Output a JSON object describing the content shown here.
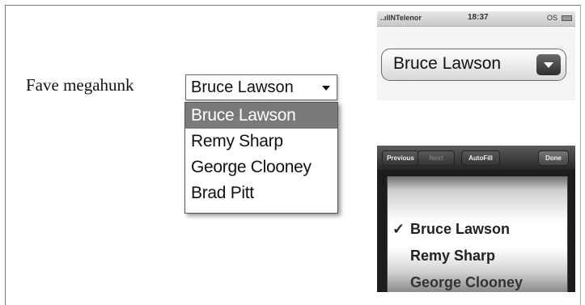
{
  "form": {
    "label": "Fave megahunk",
    "selected": "Bruce Lawson",
    "options": [
      "Bruce Lawson",
      "Remy Sharp",
      "George Clooney",
      "Brad Pitt"
    ]
  },
  "iphone": {
    "status": {
      "carrier": "..ıllNTelenor",
      "time": "18:37",
      "battery": "OS"
    },
    "select_value": "Bruce Lawson",
    "toolbar": {
      "previous": "Previous",
      "next": "Next",
      "autofill": "AutoFill",
      "done": "Done"
    },
    "picker_check": "✓",
    "picker_options": [
      "Bruce Lawson",
      "Remy Sharp",
      "George Clooney"
    ]
  }
}
